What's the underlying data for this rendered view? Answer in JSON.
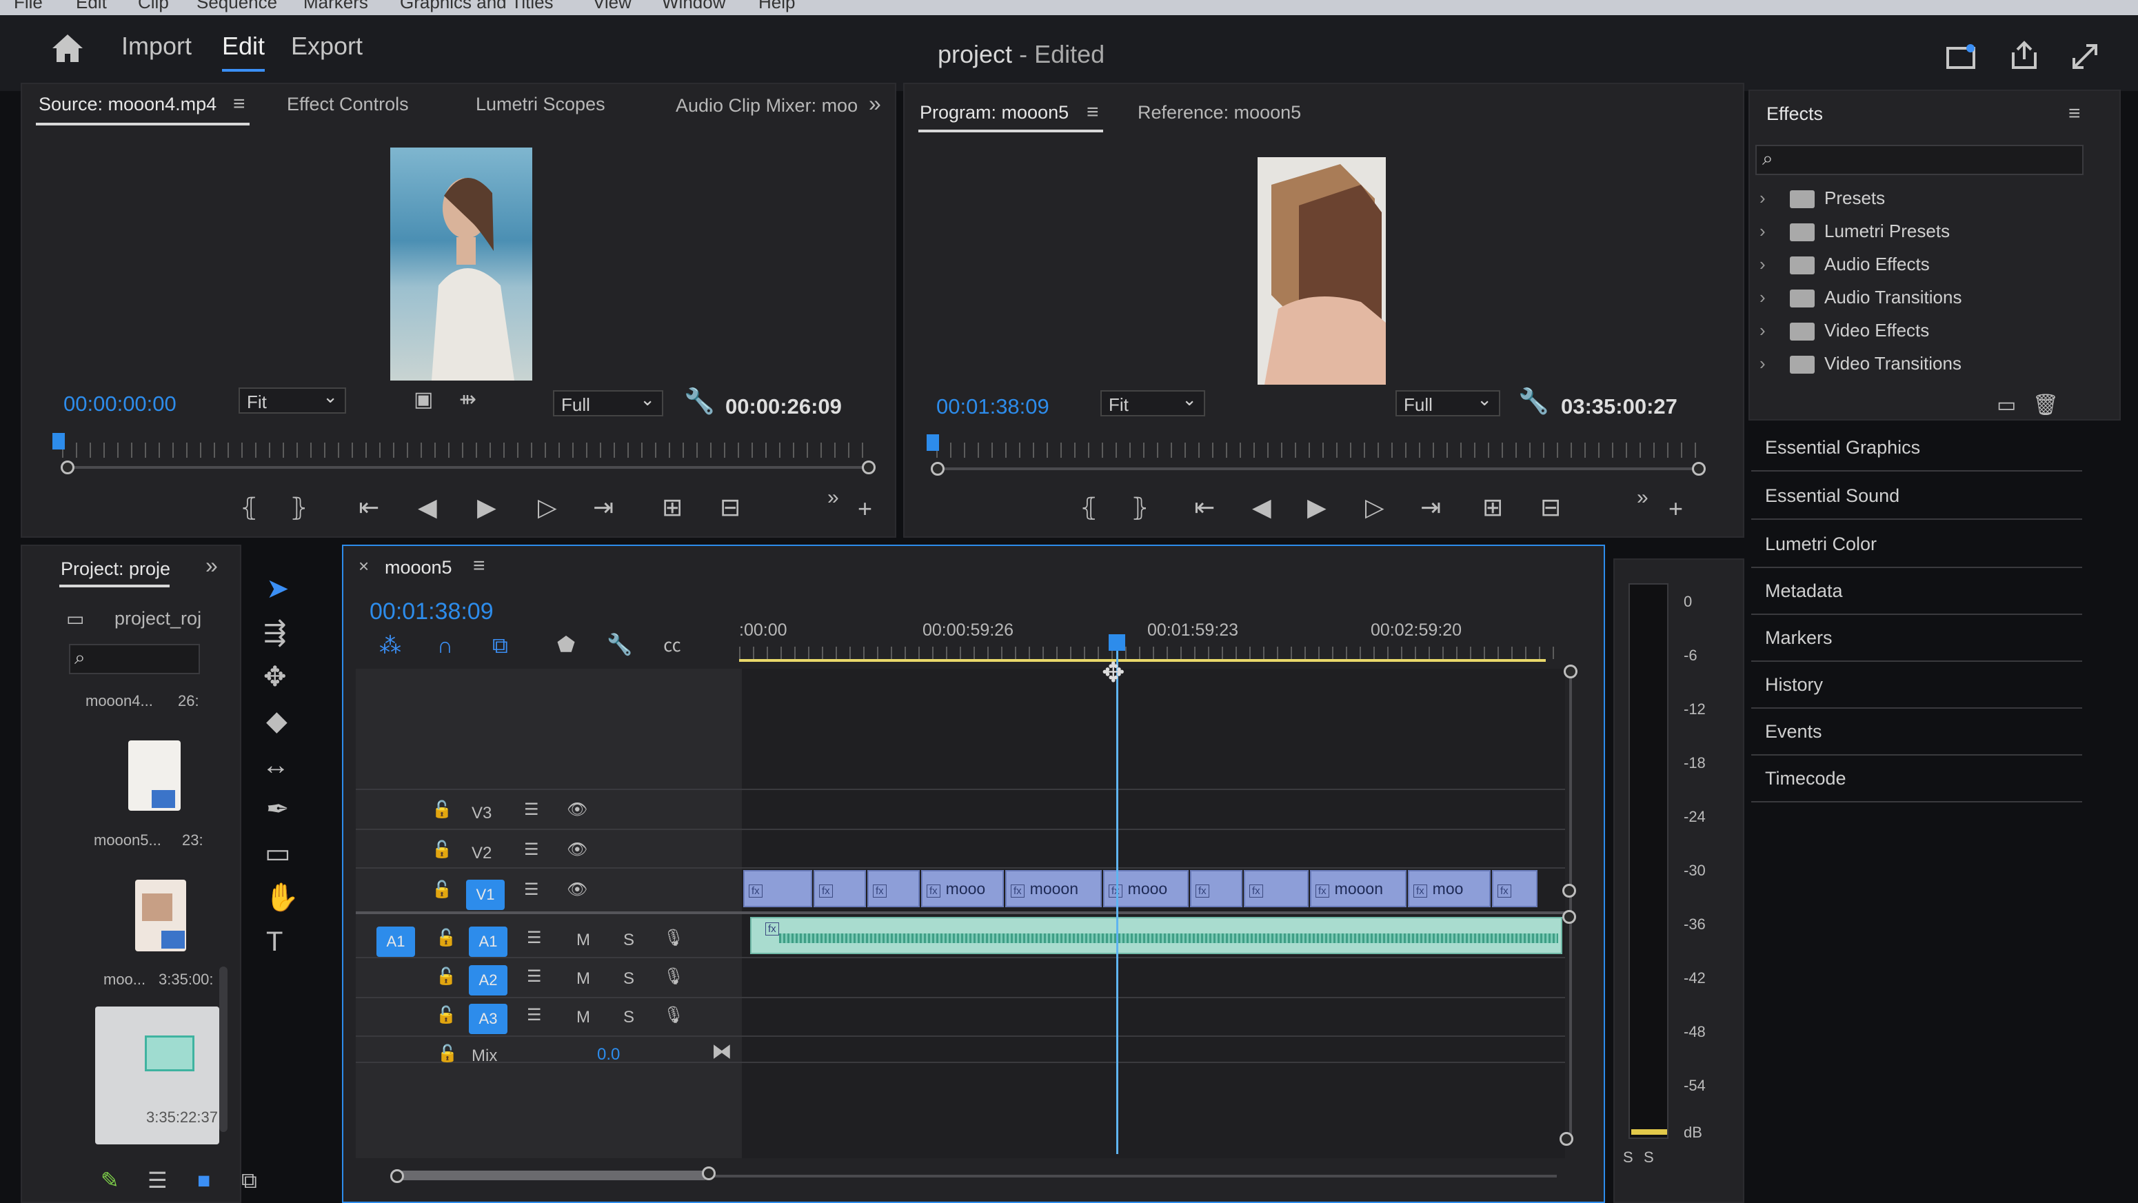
{
  "menubar": {
    "items": [
      "File",
      "Edit",
      "Clip",
      "Sequence",
      "Markers",
      "Graphics and Titles",
      "View",
      "Window",
      "Help"
    ]
  },
  "header": {
    "workspaces": [
      "Import",
      "Edit",
      "Export"
    ],
    "active_workspace": "Edit",
    "project_name": "project",
    "project_state": "- Edited"
  },
  "source_monitor": {
    "tabs": [
      "Source: mooon4.mp4",
      "Effect Controls",
      "Lumetri Scopes",
      "Audio Clip Mixer: moo"
    ],
    "current_tc": "00:00:00:00",
    "zoom": "Fit",
    "quality": "Full",
    "duration_tc": "00:00:26:09"
  },
  "program_monitor": {
    "tabs": [
      "Program: mooon5",
      "Reference: mooon5"
    ],
    "current_tc": "00:01:38:09",
    "zoom": "Fit",
    "quality": "Full",
    "duration_tc": "03:35:00:27"
  },
  "effects": {
    "title": "Effects",
    "tree": [
      "Presets",
      "Lumetri Presets",
      "Audio Effects",
      "Audio Transitions",
      "Video Effects",
      "Video Transitions"
    ],
    "panels": [
      "Essential Graphics",
      "Essential Sound",
      "Lumetri Color",
      "Metadata",
      "Markers",
      "History",
      "Events",
      "Timecode"
    ]
  },
  "project_panel": {
    "tab": "Project: proje",
    "file": "project_roj",
    "items": [
      {
        "name": "mooon4...",
        "dur": "26:"
      },
      {
        "name": "mooon5...",
        "dur": "23:"
      },
      {
        "name": "moo...",
        "dur": "3:35:00:"
      },
      {
        "name": "",
        "dur": "3:35:22:37"
      }
    ]
  },
  "timeline": {
    "sequence": "mooon5",
    "current_tc": "00:01:38:09",
    "ruler_labels": [
      ":00:00",
      "00:00:59:26",
      "00:01:59:23",
      "00:02:59:20"
    ],
    "video_tracks": [
      "V3",
      "V2",
      "V1"
    ],
    "audio_tracks": [
      "A1",
      "A2",
      "A3"
    ],
    "src_patch": "A1",
    "mix_label": "Mix",
    "mix_value": "0.0",
    "track_buttons": {
      "mute": "M",
      "solo": "S"
    },
    "v1_clips": [
      "",
      "",
      "",
      "mooo",
      "mooon",
      "mooo",
      "",
      "",
      "mooon",
      "moo",
      ""
    ]
  },
  "audio_meter": {
    "scale": [
      "0",
      "-6",
      "-12",
      "-18",
      "-24",
      "-30",
      "-36",
      "-42",
      "-48",
      "-54",
      "dB"
    ],
    "solo": [
      "S",
      "S"
    ]
  },
  "colors": {
    "accent": "#2d8ceb",
    "clip_video": "#8d9ed8",
    "clip_audio": "#3f9e86",
    "playhead": "#5fb4f0"
  }
}
